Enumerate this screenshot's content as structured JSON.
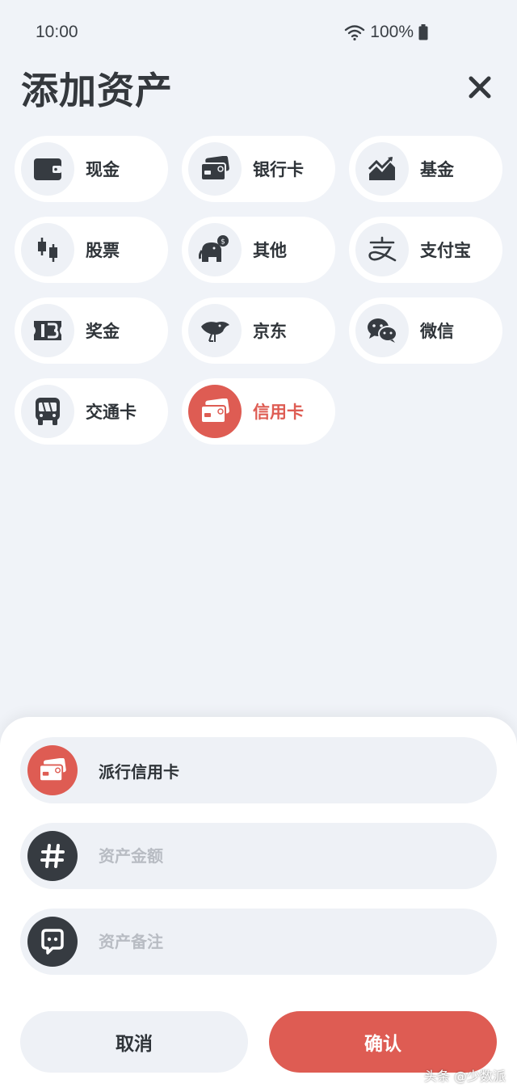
{
  "status_bar": {
    "time": "10:00",
    "battery": "100%"
  },
  "header": {
    "title": "添加资产",
    "close_icon": "close-icon"
  },
  "asset_types": [
    {
      "label": "现金",
      "icon": "wallet-icon"
    },
    {
      "label": "银行卡",
      "icon": "bank-card-icon"
    },
    {
      "label": "基金",
      "icon": "chart-trend-icon"
    },
    {
      "label": "股票",
      "icon": "candlestick-icon"
    },
    {
      "label": "其他",
      "icon": "elephant-piggybank-icon"
    },
    {
      "label": "支付宝",
      "icon": "alipay-icon"
    },
    {
      "label": "奖金",
      "icon": "ticket-icon"
    },
    {
      "label": "京东",
      "icon": "jd-bird-icon"
    },
    {
      "label": "微信",
      "icon": "wechat-icon"
    },
    {
      "label": "交通卡",
      "icon": "bus-icon"
    },
    {
      "label": "信用卡",
      "icon": "credit-card-icon",
      "selected": true
    }
  ],
  "form": {
    "name_value": "派行信用卡",
    "amount_placeholder": "资产金额",
    "note_placeholder": "资产备注"
  },
  "buttons": {
    "cancel": "取消",
    "confirm": "确认"
  },
  "watermark": "头条 @少数派",
  "colors": {
    "accent": "#de5c53",
    "background": "#f0f3f8",
    "field_bg": "#eef1f6",
    "dark": "#363b41"
  }
}
